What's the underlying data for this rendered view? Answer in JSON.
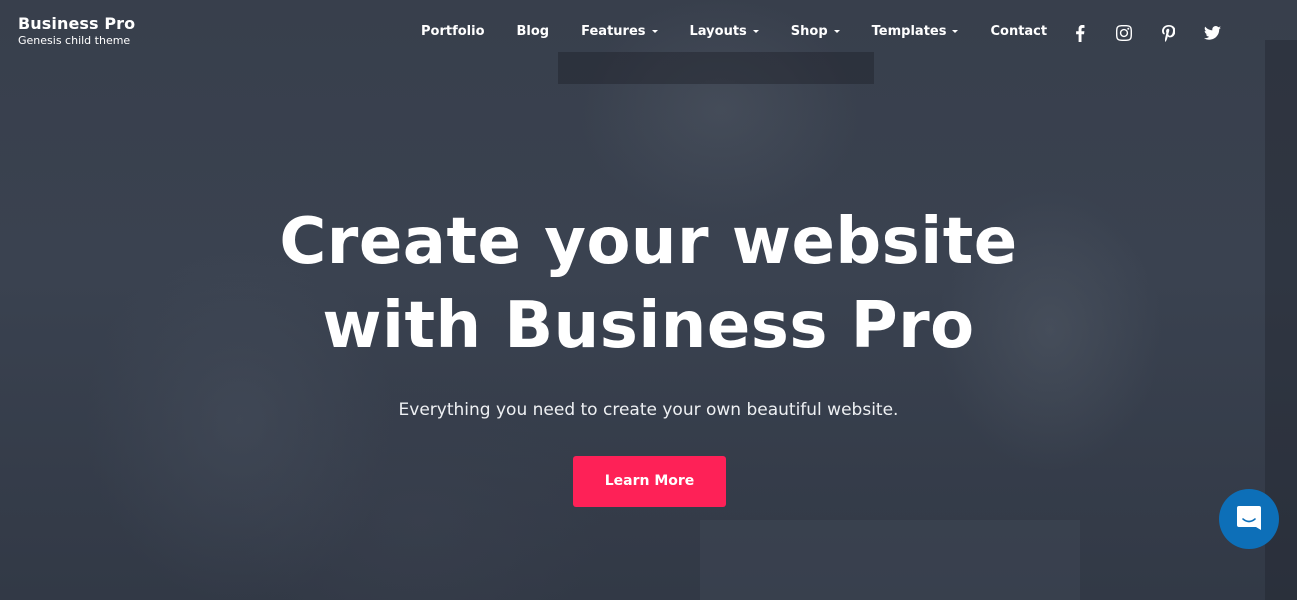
{
  "brand": {
    "title": "Business Pro",
    "tagline": "Genesis child theme"
  },
  "nav": {
    "items": [
      {
        "label": "Portfolio",
        "has_dropdown": false
      },
      {
        "label": "Blog",
        "has_dropdown": false
      },
      {
        "label": "Features",
        "has_dropdown": true
      },
      {
        "label": "Layouts",
        "has_dropdown": true
      },
      {
        "label": "Shop",
        "has_dropdown": true
      },
      {
        "label": "Templates",
        "has_dropdown": true
      },
      {
        "label": "Contact",
        "has_dropdown": false
      }
    ]
  },
  "social": {
    "icons": [
      "facebook-icon",
      "instagram-icon",
      "pinterest-icon",
      "twitter-icon"
    ]
  },
  "hero": {
    "title": "Create your website with Business Pro",
    "subtitle": "Everything you need to create your own beautiful website.",
    "cta_label": "Learn More"
  },
  "chat": {
    "icon": "chat-bubble-icon"
  },
  "colors": {
    "accent": "#fe2157",
    "chat": "#0d6fb8",
    "overlay": "#343c49"
  }
}
